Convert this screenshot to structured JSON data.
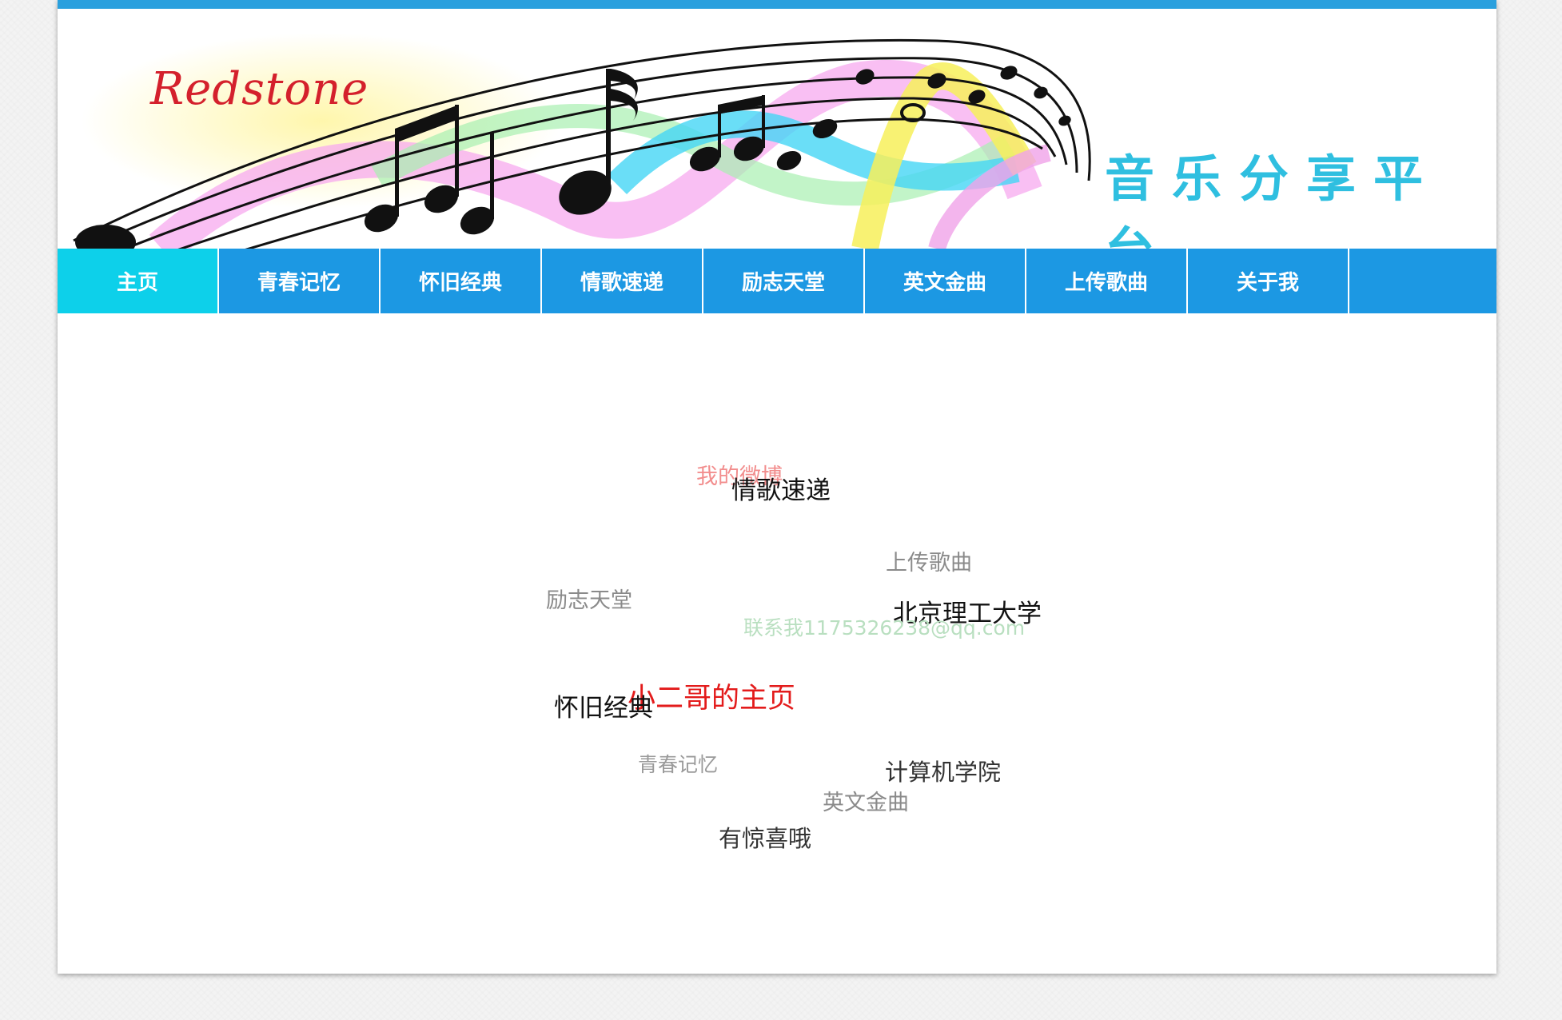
{
  "banner": {
    "brand": "Redstone",
    "slogan": "音乐分享平台"
  },
  "nav": {
    "items": [
      {
        "label": "主页",
        "active": true
      },
      {
        "label": "青春记忆",
        "active": false
      },
      {
        "label": "怀旧经典",
        "active": false
      },
      {
        "label": "情歌速递",
        "active": false
      },
      {
        "label": "励志天堂",
        "active": false
      },
      {
        "label": "英文金曲",
        "active": false
      },
      {
        "label": "上传歌曲",
        "active": false
      },
      {
        "label": "关于我",
        "active": false
      }
    ]
  },
  "tag_cloud": {
    "tags": [
      {
        "text": "我的微博",
        "color": "#f28d8d"
      },
      {
        "text": "情歌速递",
        "color": "#111111"
      },
      {
        "text": "上传歌曲",
        "color": "#8a8a8a"
      },
      {
        "text": "励志天堂",
        "color": "#8a8a8a"
      },
      {
        "text": "北京理工大学",
        "color": "#111111"
      },
      {
        "text": "联系我1175326238@qq.com",
        "color": "#b9dfc0"
      },
      {
        "text": "小二哥的主页",
        "color": "#e31b1b"
      },
      {
        "text": "怀旧经典",
        "color": "#111111"
      },
      {
        "text": "青春记忆",
        "color": "#9a9a9a"
      },
      {
        "text": "计算机学院",
        "color": "#333333"
      },
      {
        "text": "英文金曲",
        "color": "#8a8a8a"
      },
      {
        "text": "有惊喜哦",
        "color": "#333333"
      }
    ]
  },
  "colors": {
    "accent": "#1c98e3",
    "active_nav": "#0dd0ea",
    "top_strip": "#2aa0de",
    "brand": "#d4202c",
    "slogan": "#2fbfe0"
  }
}
